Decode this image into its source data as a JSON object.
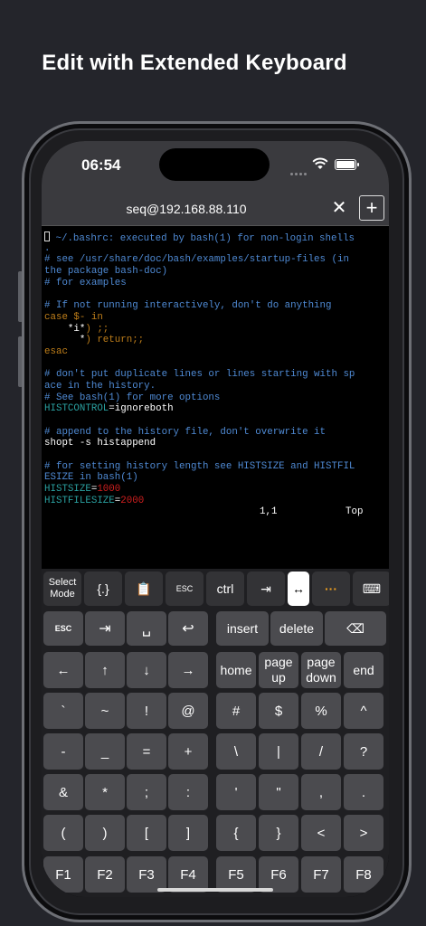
{
  "headline": "Edit with Extended Keyboard",
  "status": {
    "time": "06:54"
  },
  "tab": {
    "title": "seq@192.168.88.110",
    "close_icon": "x-icon",
    "add_icon": "plus-icon"
  },
  "terminal": {
    "lines": [
      [
        [
          "cursor",
          ""
        ],
        [
          "cmt",
          " ~/.bashrc: executed by bash(1) for non-login shells"
        ]
      ],
      [
        [
          "cmt",
          "."
        ]
      ],
      [
        [
          "cmt",
          "# see /usr/share/doc/bash/examples/startup-files (in"
        ]
      ],
      [
        [
          "cmt",
          "the package bash-doc)"
        ]
      ],
      [
        [
          "cmt",
          "# for examples"
        ]
      ],
      [],
      [
        [
          "cmt",
          "# If not running interactively, don't do anything"
        ]
      ],
      [
        [
          "kw",
          "case $- in"
        ]
      ],
      [
        [
          "txt",
          "    *i*"
        ],
        [
          "kw",
          ") ;;"
        ]
      ],
      [
        [
          "txt",
          "      *"
        ],
        [
          "kw",
          ") return;;"
        ]
      ],
      [
        [
          "kw",
          "esac"
        ]
      ],
      [],
      [
        [
          "cmt",
          "# don't put duplicate lines or lines starting with sp"
        ]
      ],
      [
        [
          "cmt",
          "ace in the history."
        ]
      ],
      [
        [
          "cmt",
          "# See bash(1) for more options"
        ]
      ],
      [
        [
          "var",
          "HISTCONTROL"
        ],
        [
          "txt",
          "=ignoreboth"
        ]
      ],
      [],
      [
        [
          "cmt",
          "# append to the history file, don't overwrite it"
        ]
      ],
      [
        [
          "txt",
          "shopt -s histappend"
        ]
      ],
      [],
      [
        [
          "cmt",
          "# for setting history length see HISTSIZE and HISTFIL"
        ]
      ],
      [
        [
          "cmt",
          "ESIZE in bash(1)"
        ]
      ],
      [
        [
          "var",
          "HISTSIZE"
        ],
        [
          "txt",
          "="
        ],
        [
          "num",
          "1000"
        ]
      ],
      [
        [
          "var",
          "HISTFILESIZE"
        ],
        [
          "txt",
          "="
        ],
        [
          "num",
          "2000"
        ]
      ]
    ],
    "ruler_pos": "1,1",
    "ruler_where": "Top"
  },
  "toolbar": [
    {
      "label": "Select\nMode",
      "name": "select-mode-button"
    },
    {
      "label": "{.}",
      "name": "snippet-button"
    },
    {
      "label": "📋",
      "name": "clipboard-icon-button"
    },
    {
      "label": "ESC",
      "name": "esc-toolbar-button"
    },
    {
      "label": "ctrl",
      "name": "ctrl-toolbar-button"
    },
    {
      "label": "⇥",
      "name": "tab-toolbar-button"
    },
    {
      "label": "↔",
      "name": "drag-mode-button"
    },
    {
      "label": "···",
      "name": "more-button"
    },
    {
      "label": "⌨",
      "name": "keyboard-hide-button"
    }
  ],
  "rows": [
    [
      {
        "label": "ESC",
        "name": "esc-key"
      },
      {
        "label": "⇥",
        "name": "tab-key"
      },
      {
        "label": "␣",
        "name": "space-key"
      },
      {
        "label": "↩",
        "name": "return-key"
      },
      {
        "label": "insert",
        "name": "insert-key"
      },
      {
        "label": "delete",
        "name": "delete-key"
      },
      {
        "label": "⌫",
        "name": "backspace-key"
      }
    ],
    [
      {
        "label": "←",
        "name": "arrow-left-key"
      },
      {
        "label": "↑",
        "name": "arrow-up-key"
      },
      {
        "label": "↓",
        "name": "arrow-down-key"
      },
      {
        "label": "→",
        "name": "arrow-right-key"
      },
      {
        "label": "home",
        "name": "home-key"
      },
      {
        "label": "page\nup",
        "name": "page-up-key"
      },
      {
        "label": "page\ndown",
        "name": "page-down-key"
      },
      {
        "label": "end",
        "name": "end-key"
      }
    ],
    [
      {
        "label": "`"
      },
      {
        "label": "~"
      },
      {
        "label": "!"
      },
      {
        "label": "@"
      },
      {
        "label": "#"
      },
      {
        "label": "$"
      },
      {
        "label": "%"
      },
      {
        "label": "^"
      }
    ],
    [
      {
        "label": "-"
      },
      {
        "label": "_"
      },
      {
        "label": "="
      },
      {
        "label": "+"
      },
      {
        "label": "\\"
      },
      {
        "label": "|"
      },
      {
        "label": "/"
      },
      {
        "label": "?"
      }
    ],
    [
      {
        "label": "&"
      },
      {
        "label": "*"
      },
      {
        "label": ";"
      },
      {
        "label": ":"
      },
      {
        "label": "'"
      },
      {
        "label": "\""
      },
      {
        "label": ","
      },
      {
        "label": "."
      }
    ],
    [
      {
        "label": "("
      },
      {
        "label": ")"
      },
      {
        "label": "["
      },
      {
        "label": "]"
      },
      {
        "label": "{"
      },
      {
        "label": "}"
      },
      {
        "label": "<"
      },
      {
        "label": ">"
      }
    ],
    [
      {
        "label": "F1"
      },
      {
        "label": "F2"
      },
      {
        "label": "F3"
      },
      {
        "label": "F4"
      },
      {
        "label": "F5"
      },
      {
        "label": "F6"
      },
      {
        "label": "F7"
      },
      {
        "label": "F8"
      }
    ]
  ],
  "colors": {
    "comment": "#4f8ad4",
    "keyword": "#c07f1a",
    "variable": "#2aa0a0",
    "number": "#d21f1f",
    "more_icon": "#f0a020"
  }
}
